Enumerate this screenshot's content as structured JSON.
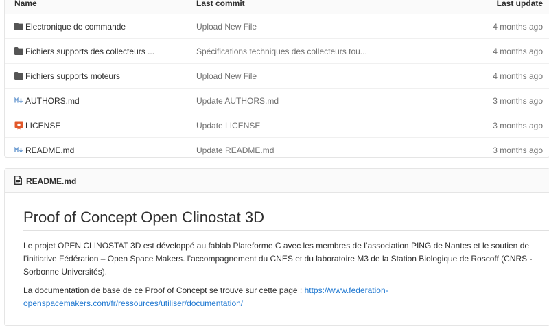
{
  "files": {
    "headers": {
      "name": "Name",
      "last_commit": "Last commit",
      "last_update": "Last update"
    },
    "rows": [
      {
        "icon": "folder-icon",
        "name": "Electronique de commande",
        "commit": "Upload New File",
        "update": "4 months ago"
      },
      {
        "icon": "folder-icon",
        "name": "Fichiers supports des collecteurs ...",
        "commit": "Spécifications techniques des collecteurs tou...",
        "update": "4 months ago"
      },
      {
        "icon": "folder-icon",
        "name": "Fichiers supports moteurs",
        "commit": "Upload New File",
        "update": "4 months ago"
      },
      {
        "icon": "markdown-icon",
        "name": "AUTHORS.md",
        "commit": "Update AUTHORS.md",
        "update": "3 months ago"
      },
      {
        "icon": "license-icon",
        "name": "LICENSE",
        "commit": "Update LICENSE",
        "update": "3 months ago"
      },
      {
        "icon": "markdown-icon",
        "name": "README.md",
        "commit": "Update README.md",
        "update": "3 months ago"
      }
    ]
  },
  "readme": {
    "filename": "README.md",
    "title": "Proof of Concept Open Clinostat 3D",
    "paragraph1": "Le projet OPEN CLINOSTAT 3D est développé au fablab Plateforme C avec les membres de l’association PING de Nantes et le soutien de l’initiative Fédération – Open Space Makers. l’accompagnement du CNES et du laboratoire M3 de la Station Biologique de Roscoff (CNRS - Sorbonne Universités).",
    "paragraph2_text": "La documentation de base de ce Proof of Concept se trouve sur cette page : ",
    "paragraph2_link": "https://www.federation-openspacemakers.com/fr/ressources/utiliser/documentation/"
  },
  "colors": {
    "link": "#1f78d1",
    "muted": "#707070",
    "markdown": "#6b9bd1",
    "license": "#e2582a"
  }
}
